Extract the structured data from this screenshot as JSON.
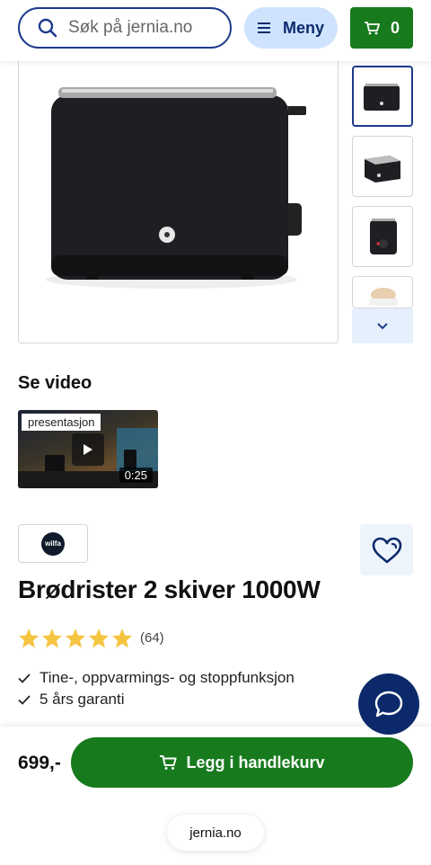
{
  "header": {
    "search_placeholder": "Søk på jernia.no",
    "menu_label": "Meny",
    "cart_count": "0"
  },
  "gallery": {
    "thumbnails": [
      "toaster-front",
      "toaster-angle",
      "toaster-control",
      "toaster-with-bread"
    ],
    "active_index": 0
  },
  "video": {
    "heading": "Se video",
    "tag": "presentasjon",
    "duration": "0:25"
  },
  "brand": {
    "logo_text": "wilfa"
  },
  "product": {
    "title": "Brødrister 2 skiver 1000W",
    "rating": 5,
    "rating_count": "(64)",
    "features": [
      "Tine-, oppvarmings- og stoppfunksjon",
      "5 års garanti"
    ]
  },
  "bottom": {
    "price": "699,-",
    "add_to_cart_label": "Legg i handlekurv",
    "url": "jernia.no"
  },
  "colors": {
    "primary_green": "#177a1d",
    "navy": "#0c2a6b",
    "star": "#f5c542"
  }
}
